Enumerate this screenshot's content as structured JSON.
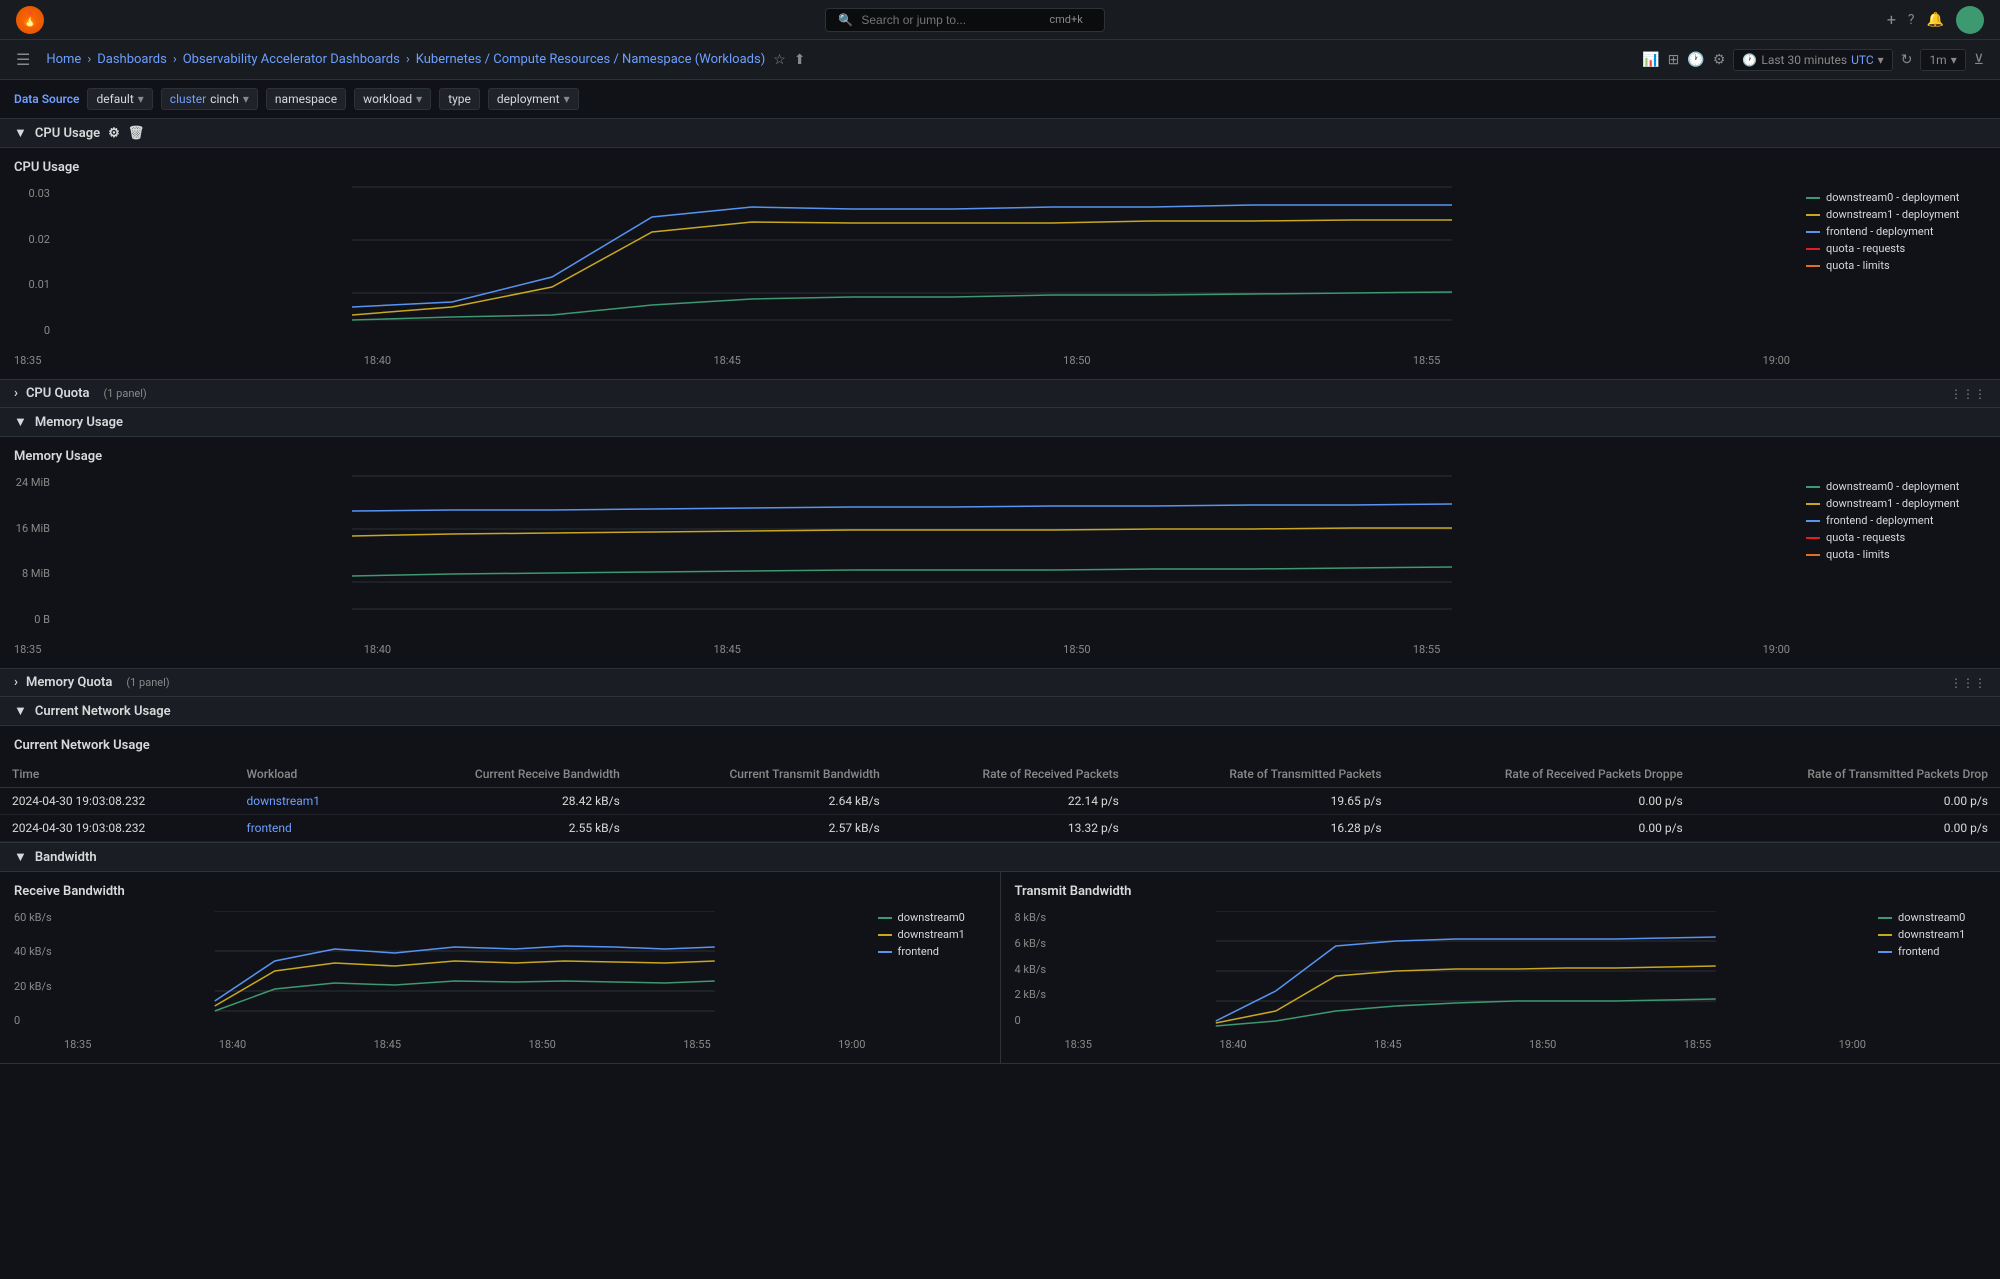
{
  "topbar": {
    "search_placeholder": "Search or jump to...",
    "shortcut": "cmd+k",
    "add_label": "+",
    "help_icon": "?",
    "notification_icon": "bell"
  },
  "nav": {
    "home": "Home",
    "dashboards": "Dashboards",
    "observability": "Observability Accelerator Dashboards",
    "kubernetes": "Kubernetes / Compute Resources / Namespace (Workloads)"
  },
  "timerange": {
    "label": "Last 30 minutes",
    "utc": "UTC",
    "interval": "1m"
  },
  "filters": {
    "data_source_label": "Data Source",
    "default_label": "default",
    "cluster_label": "cluster",
    "cluster_value": "cinch",
    "namespace_label": "namespace",
    "workload_label": "workload",
    "type_label": "type",
    "deployment_label": "deployment"
  },
  "sections": {
    "cpu_usage": "CPU Usage",
    "cpu_quota": "CPU Quota",
    "cpu_quota_panels": "1 panel",
    "memory_usage": "Memory Usage",
    "memory_quota": "Memory Quota",
    "memory_quota_panels": "1 panel",
    "network_usage": "Current Network Usage",
    "bandwidth": "Bandwidth"
  },
  "cpu_chart": {
    "title": "CPU Usage",
    "y_labels": [
      "0.03",
      "0.02",
      "0.01",
      "0"
    ],
    "x_labels": [
      "18:35",
      "18:40",
      "18:45",
      "18:50",
      "18:55",
      "19:00"
    ],
    "legend": [
      {
        "label": "downstream0 - deployment",
        "color": "#3d9970"
      },
      {
        "label": "downstream1 - deployment",
        "color": "#c8a820"
      },
      {
        "label": "frontend - deployment",
        "color": "#5794f2"
      },
      {
        "label": "quota - requests",
        "color": "#e02020"
      },
      {
        "label": "quota - limits",
        "color": "#e07020"
      }
    ]
  },
  "memory_chart": {
    "title": "Memory Usage",
    "y_labels": [
      "24 MiB",
      "16 MiB",
      "8 MiB",
      "0 B"
    ],
    "x_labels": [
      "18:35",
      "18:40",
      "18:45",
      "18:50",
      "18:55",
      "19:00"
    ],
    "legend": [
      {
        "label": "downstream0 - deployment",
        "color": "#3d9970"
      },
      {
        "label": "downstream1 - deployment",
        "color": "#c8a820"
      },
      {
        "label": "frontend - deployment",
        "color": "#5794f2"
      },
      {
        "label": "quota - requests",
        "color": "#e02020"
      },
      {
        "label": "quota - limits",
        "color": "#e07020"
      }
    ]
  },
  "network_table": {
    "title": "Current Network Usage",
    "columns": [
      "Time",
      "Workload",
      "Current Receive Bandwidth",
      "Current Transmit Bandwidth",
      "Rate of Received Packets",
      "Rate of Transmitted Packets",
      "Rate of Received Packets Droppe",
      "Rate of Transmitted Packets Drop"
    ],
    "rows": [
      {
        "time": "2024-04-30 19:03:08.232",
        "workload": "downstream1",
        "recv_bw": "28.42 kB/s",
        "trans_bw": "2.64 kB/s",
        "recv_pkt": "22.14 p/s",
        "trans_pkt": "19.65 p/s",
        "recv_drop": "0.00 p/s",
        "trans_drop": "0.00 p/s"
      },
      {
        "time": "2024-04-30 19:03:08.232",
        "workload": "frontend",
        "recv_bw": "2.55 kB/s",
        "trans_bw": "2.57 kB/s",
        "recv_pkt": "13.32 p/s",
        "trans_pkt": "16.28 p/s",
        "recv_drop": "0.00 p/s",
        "trans_drop": "0.00 p/s"
      }
    ]
  },
  "receive_bandwidth": {
    "title": "Receive Bandwidth",
    "y_labels": [
      "60 kB/s",
      "40 kB/s",
      "20 kB/s",
      "0"
    ],
    "x_labels": [
      "18:35",
      "18:40",
      "18:45",
      "18:50",
      "18:55",
      "19:00"
    ],
    "legend": [
      {
        "label": "downstream0",
        "color": "#3d9970"
      },
      {
        "label": "downstream1",
        "color": "#c8a820"
      },
      {
        "label": "frontend",
        "color": "#5794f2"
      }
    ]
  },
  "transmit_bandwidth": {
    "title": "Transmit Bandwidth",
    "y_labels": [
      "8 kB/s",
      "6 kB/s",
      "4 kB/s",
      "2 kB/s",
      "0"
    ],
    "x_labels": [
      "18:35",
      "18:40",
      "18:45",
      "18:50",
      "18:55",
      "19:00"
    ],
    "legend": [
      {
        "label": "downstream0",
        "color": "#3d9970"
      },
      {
        "label": "downstream1",
        "color": "#c8a820"
      },
      {
        "label": "frontend",
        "color": "#5794f2"
      }
    ]
  }
}
